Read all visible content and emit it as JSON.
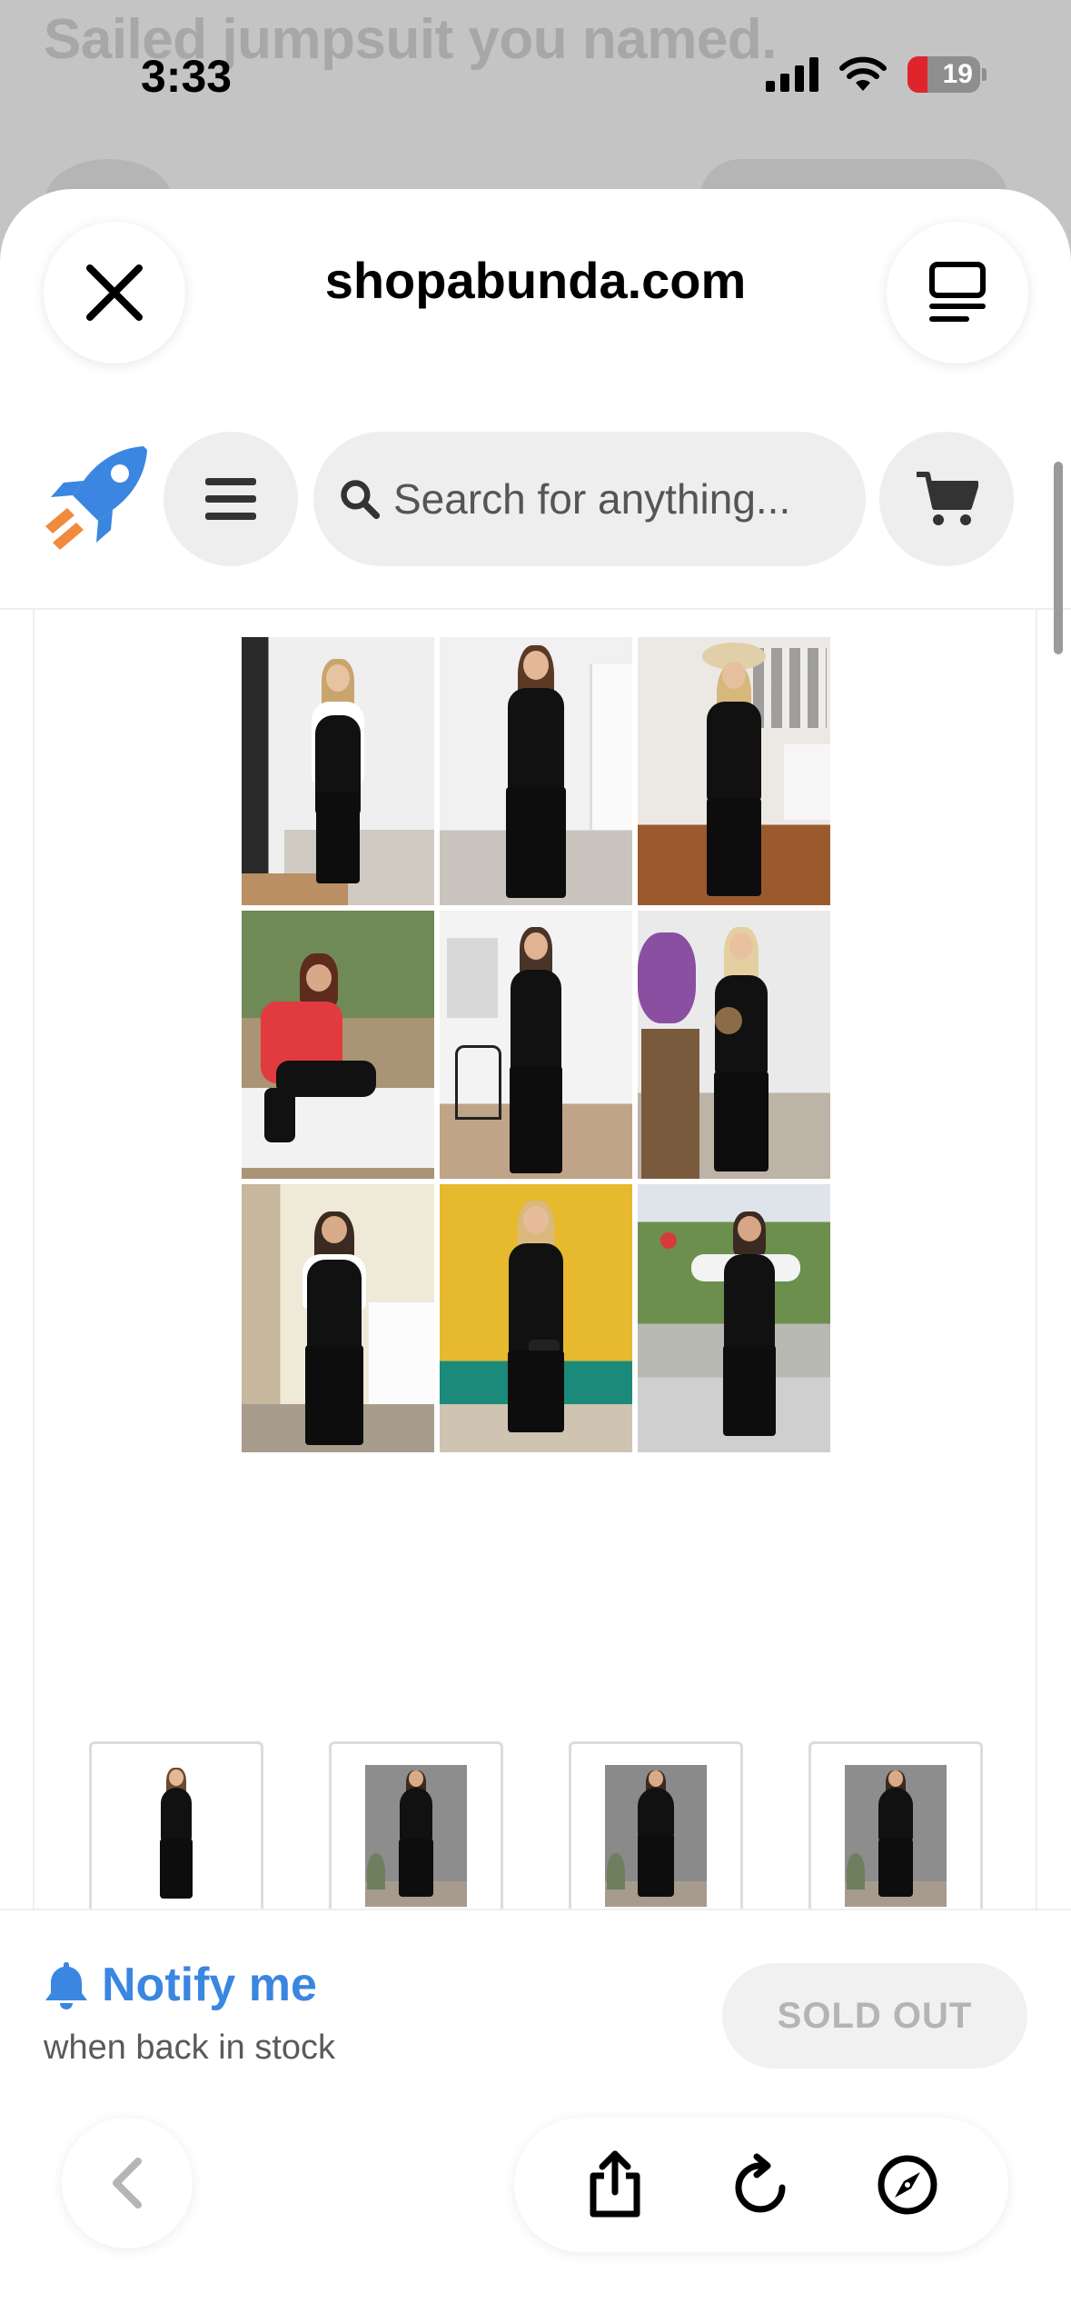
{
  "background": {
    "title": "Sailed jumpsuit you named."
  },
  "status_bar": {
    "time": "3:33",
    "battery": "19",
    "battery_color": "#e0242c"
  },
  "browser": {
    "site_title": "shopabunda.com",
    "close_icon": "close-icon",
    "reader_icon": "reader-mode-icon"
  },
  "site_header": {
    "logo": "rocket-logo",
    "menu_icon": "hamburger-menu-icon",
    "search_placeholder": "Search for anything...",
    "cart_icon": "cart-icon",
    "brand_color": "#3a86e0",
    "accent_color": "#f08a3c"
  },
  "product": {
    "main_image": "jumpsuit-collage-9-photos",
    "thumbnails": [
      {
        "image": "jumpsuit-studio-front",
        "selected": false
      },
      {
        "image": "jumpsuit-grey-wall-1",
        "selected": false
      },
      {
        "image": "jumpsuit-grey-wall-2",
        "selected": false
      },
      {
        "image": "jumpsuit-grey-wall-3",
        "selected": false
      },
      {
        "image": "jumpsuit-collage",
        "selected": true
      },
      {
        "image": "jumpsuit-belted-1",
        "selected": false
      },
      {
        "image": "jumpsuit-belted-2",
        "selected": false
      }
    ],
    "selected_border_color": "#f2a623"
  },
  "purchase": {
    "notify_label": "Notify me",
    "notify_sub": "when back in stock",
    "sold_out_label": "SOLD OUT"
  },
  "toolbar": {
    "back_icon": "chevron-left-icon",
    "share_icon": "share-icon",
    "reload_icon": "reload-icon",
    "safari_icon": "compass-icon"
  }
}
